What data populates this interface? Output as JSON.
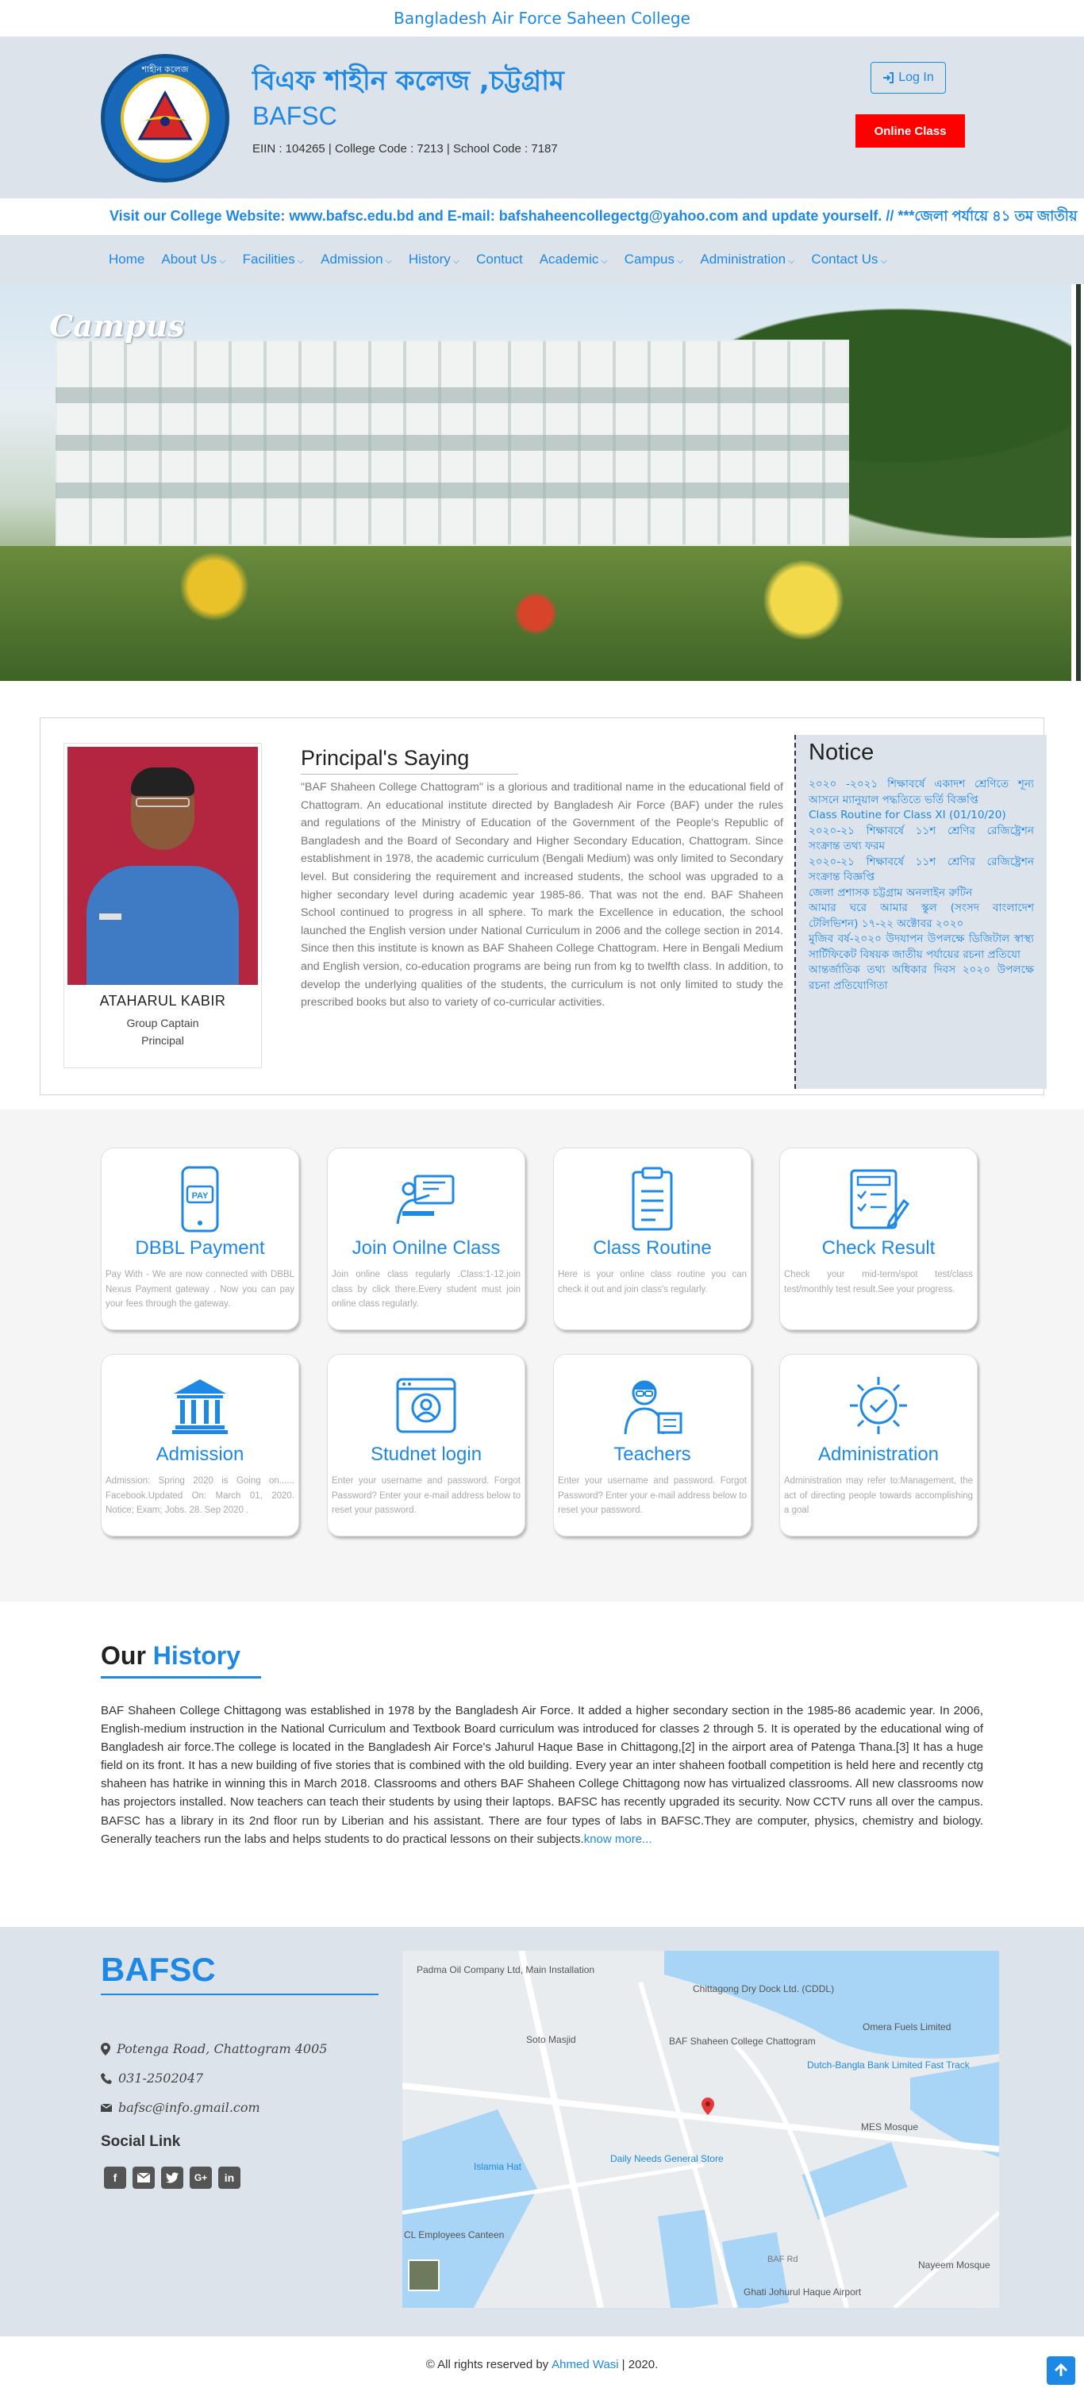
{
  "topbar": {
    "title": "Bangladesh Air Force Saheen College"
  },
  "header": {
    "title_bn": "বিএফ শাহীন কলেজ ,চট্টগ্রাম",
    "title_en": "BAFSC",
    "codes": "EIIN : 104265 | College Code : 7213 | School Code : 7187",
    "logo_text": "শাহীন কলেজ",
    "login_label": "Log In",
    "online_class_label": "Online Class"
  },
  "marquee": {
    "text": "Visit our College Website: www.bafsc.edu.bd and E-mail: bafshaheencollegectg@yahoo.com and update yourself. // ***জেলা পর্যায়ে ৪১ তম জাতীয়"
  },
  "nav": {
    "items": [
      {
        "label": "Home",
        "dropdown": false
      },
      {
        "label": "About Us",
        "dropdown": true
      },
      {
        "label": "Facilities",
        "dropdown": true
      },
      {
        "label": "Admission",
        "dropdown": true
      },
      {
        "label": "History",
        "dropdown": true
      },
      {
        "label": "Contuct",
        "dropdown": false
      },
      {
        "label": "Academic",
        "dropdown": true
      },
      {
        "label": "Campus",
        "dropdown": true
      },
      {
        "label": "Administration",
        "dropdown": true
      },
      {
        "label": "Contact Us",
        "dropdown": true
      }
    ]
  },
  "hero": {
    "caption": "Campus"
  },
  "principal": {
    "name": "ATAHARUL KABIR",
    "rank": "Group Captain",
    "role": "Principal",
    "saying_title": "Principal's Saying",
    "saying_text": "\"BAF Shaheen College Chattogram\" is a glorious and traditional name in the educational field of Chattogram. An educational institute directed by Bangladesh Air Force (BAF) under the rules and regulations of the Ministry of Education of the Government of the People's Republic of Bangladesh and the Board of Secondary and Higher Secondary Education, Chattogram. Since establishment in 1978, the academic curriculum (Bengali Medium) was only limited to Secondary level. But considering the requirement and increased students, the school was upgraded to a higher secondary level during academic year 1985-86. That was not the end. BAF Shaheen School continued to progress in all sphere. To mark the Excellence in education, the school launched the English version under National Curriculum in 2006 and the college section in 2014. Since then this institute is known as BAF Shaheen College Chattogram. Here in Bengali Medium and English version, co-education programs are being run from kg to twelfth class. In addition, to develop the underlying qualities of the students, the curriculum is not only limited to study the prescribed books but also to variety of co-curricular activities."
  },
  "notice": {
    "title": "Notice",
    "items": [
      "২০২০ -২০২১ শিক্ষাবর্ষে একাদশ শ্রেণিতে শূন্য আসনে ম্যানুয়াল পদ্ধতিতে ভর্তি বিজ্ঞপ্তি",
      "Class Routine for Class XI (01/10/20)",
      "২০২০-২১ শিক্ষাবর্ষে ১১শ শ্রেণির রেজিষ্ট্রেশন সংক্রান্ত তথ্য ফরম",
      "২০২০-২১ শিক্ষাবর্ষে ১১শ শ্রেণির রেজিষ্ট্রেশন সংক্রান্ত বিজ্ঞপ্তি",
      "জেলা প্রশাসক চট্টগ্রাম অনলাইন রুটিন",
      "আমার ঘরে আমার স্কুল (সংসদ বাংলাদেশ টেলিভিশন) ১৭-২২ অক্টোবর ২০২০",
      "মুজিব বর্ষ-২০২০ উদযাপন উপলক্ষে ডিজিটাল স্বাস্থ্য সার্টিফিকেট বিষয়ক জাতীয় পর্যায়ের রচনা প্রতিযো",
      "আন্তর্জাতিক তথ্য অধিকার দিবস ২০২০ উপলক্ষে রচনা প্রতিযোগিতা"
    ]
  },
  "services": [
    {
      "title": "DBBL Payment",
      "desc": "Pay With - We are now connected with DBBL Nexus Payment gateway . Now you can pay your fees through the gateway.",
      "icon": "pay-phone-icon"
    },
    {
      "title": "Join Onilne Class",
      "desc": "Join online class regularly .Class:1-12.join class by click there.Every student must join online class regularly.",
      "icon": "online-class-icon"
    },
    {
      "title": "Class Routine",
      "desc": "Here is your online class routine you can check it out and join class's regularly.",
      "icon": "clipboard-icon"
    },
    {
      "title": "Check Result",
      "desc": "Check your mid-term/spot test/class test/monthly test result.See your progress.",
      "icon": "result-icon"
    },
    {
      "title": "Admission",
      "desc": "Admission: Spring 2020 is Going on...... Facebook.Updated On: March 01, 2020. Notice; Exam; Jobs. 28. Sep 2020 .",
      "icon": "institution-icon"
    },
    {
      "title": "Studnet login",
      "desc": "Enter your username and password. Forgot Password? Enter your e-mail address below to reset your password.",
      "icon": "student-login-icon"
    },
    {
      "title": "Teachers",
      "desc": "Enter your username and password. Forgot Password? Enter your e-mail address below to reset your password.",
      "icon": "teacher-icon"
    },
    {
      "title": "Administration",
      "desc": "Administration may refer to:Management, the act of directing people towards accomplishing a goal",
      "icon": "gear-check-icon"
    }
  ],
  "history": {
    "heading_a": "Our",
    "heading_b": "History",
    "text": "BAF Shaheen College Chittagong was established in 1978 by the Bangladesh Air Force. It added a higher secondary section in the 1985-86 academic year. In 2006, English-medium instruction in the National Curriculum and Textbook Board curriculum was introduced for classes 2 through 5. It is operated by the educational wing of Bangladesh air force.The college is located in the Bangladesh Air Force's Jahurul Haque Base in Chittagong,[2] in the airport area of Patenga Thana.[3] It has a huge field on its front. It has a new building of five stories that is combined with the old building. Every year an inter shaheen football competition is held here and recently ctg shaheen has hatrike in winning this in March 2018. Classrooms and others BAF Shaheen College Chittagong now has virtualized classrooms. All new classrooms now has projectors installed. Now teachers can teach their students by using their laptops. BAFSC has recently upgraded its security. Now CCTV runs all over the campus. BAFSC has a library in its 2nd floor run by Liberian and his assistant. There are four types of labs in BAFSC.They are computer, physics, chemistry and biology. Generally teachers run the labs and helps students to do practical lessons on their subjects.",
    "more": "know more..."
  },
  "footer": {
    "brand": "BAFSC",
    "address": "Potenga Road, Chattogram 4005",
    "phone": "031-2502047",
    "email": "bafsc@info.gmail.com",
    "social_title": "Social Link",
    "social": [
      "facebook-icon",
      "email-icon",
      "twitter-icon",
      "google-plus-icon",
      "linkedin-icon"
    ]
  },
  "map": {
    "labels": {
      "padma": "Padma Oil Company Ltd, Main Installation",
      "dock": "Chittagong Dry Dock Ltd. (CDDL)",
      "omera": "Omera Fuels Limited",
      "soto": "Soto Masjid",
      "college": "BAF Shaheen College Chattogram",
      "dutch": "Dutch-Bangla Bank Limited Fast Track",
      "mes": "MES Mosque",
      "islamia": "Islamia Hat",
      "daily": "Daily Needs General Store",
      "canteen": "CL Employees Canteen",
      "bafrd": "BAF Rd",
      "nayeem": "Nayeem Mosque",
      "airport": "Ghati Johurul Haque Airport"
    }
  },
  "copyright": {
    "prefix": "© All rights reserved by",
    "author": "Ahmed Wasi",
    "suffix": "| 2020."
  },
  "colors": {
    "accent": "#1e88e5",
    "header_bg": "#dde3ea",
    "online_btn": "#ff0000"
  }
}
